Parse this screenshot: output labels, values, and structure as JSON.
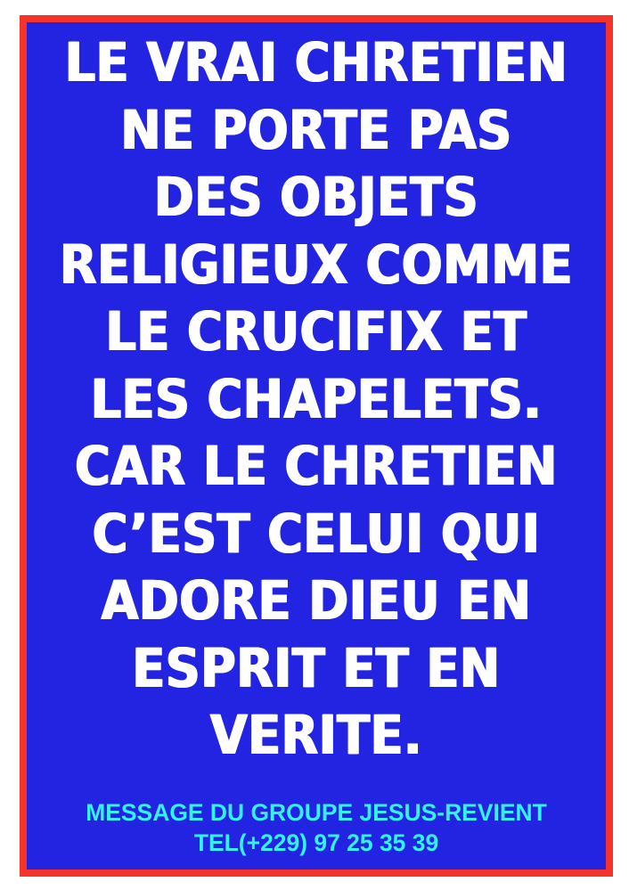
{
  "poster": {
    "frame_color": "#f5332b",
    "panel_color": "#2323e2",
    "message_color": "#ffffff",
    "footer_color": "#33f1ee",
    "lines": [
      "LE VRAI CHRETIEN",
      "NE PORTE PAS",
      "DES OBJETS",
      "RELIGIEUX COMME",
      "LE CRUCIFIX ET",
      "LES CHAPELETS.",
      "CAR LE CHRETIEN",
      "C’EST CELUI QUI",
      "ADORE DIEU EN",
      "ESPRIT ET EN",
      "VERITE."
    ],
    "footer": {
      "group": "MESSAGE DU GROUPE JESUS-REVIENT",
      "phone": "TEL(+229) 97 25 35 39"
    }
  }
}
